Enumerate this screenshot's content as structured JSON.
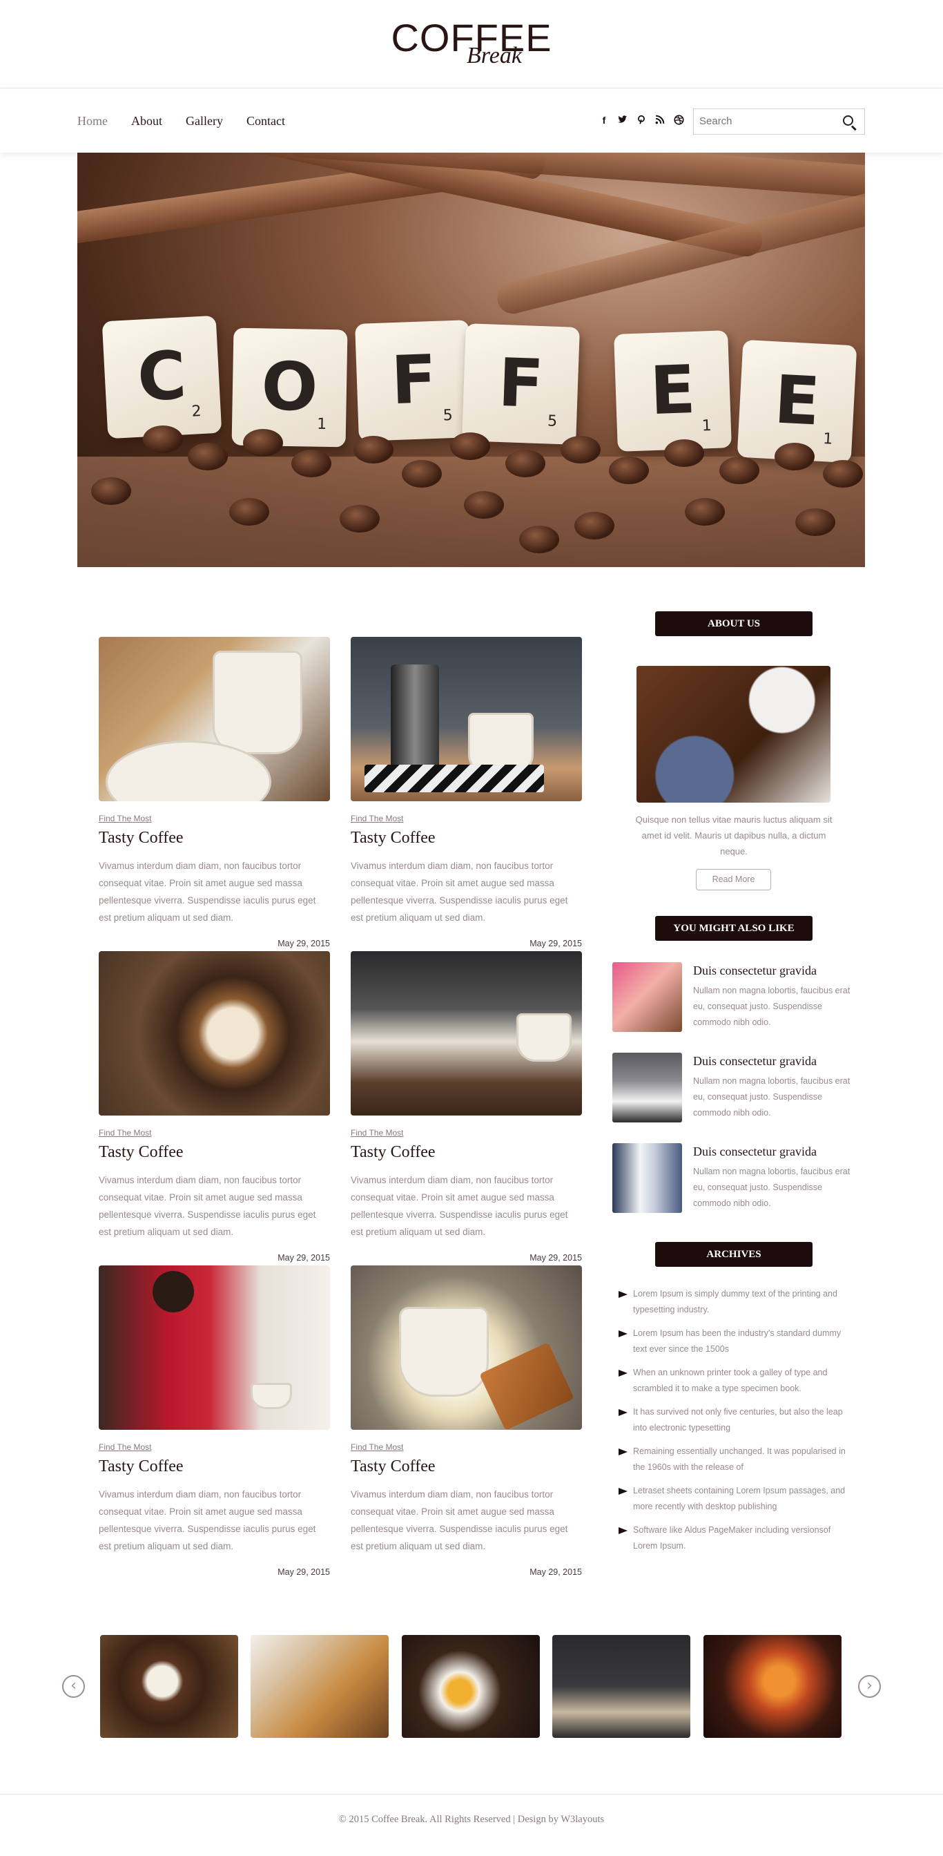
{
  "brand": {
    "name": "COFFEE",
    "script": "Break"
  },
  "nav": {
    "items": [
      {
        "label": "Home",
        "active": true
      },
      {
        "label": "About"
      },
      {
        "label": "Gallery"
      },
      {
        "label": "Contact"
      }
    ],
    "social": [
      "facebook-icon",
      "twitter-icon",
      "pinterest-icon",
      "rss-icon",
      "dribbble-icon"
    ],
    "search_placeholder": "Search"
  },
  "hero": {
    "tiles": [
      {
        "letter": "C",
        "sub": "2"
      },
      {
        "letter": "O",
        "sub": "1"
      },
      {
        "letter": "F",
        "sub": "5"
      },
      {
        "letter": "F",
        "sub": "5"
      },
      {
        "letter": "E",
        "sub": "1"
      },
      {
        "letter": "E",
        "sub": "1"
      }
    ]
  },
  "posts": [
    {
      "category": "Find The Most",
      "title": "Tasty Coffee",
      "body": "Vivamus interdum diam diam, non faucibus tortor consequat vitae. Proin sit amet augue sed massa pellentesque viverra. Suspendisse iaculis purus eget est pretium aliquam ut sed diam.",
      "date": "May 29, 2015"
    },
    {
      "category": "Find The Most",
      "title": "Tasty Coffee",
      "body": "Vivamus interdum diam diam, non faucibus tortor consequat vitae. Proin sit amet augue sed massa pellentesque viverra. Suspendisse iaculis purus eget est pretium aliquam ut sed diam.",
      "date": "May 29, 2015"
    },
    {
      "category": "Find The Most",
      "title": "Tasty Coffee",
      "body": "Vivamus interdum diam diam, non faucibus tortor consequat vitae. Proin sit amet augue sed massa pellentesque viverra. Suspendisse iaculis purus eget est pretium aliquam ut sed diam.",
      "date": "May 29, 2015"
    },
    {
      "category": "Find The Most",
      "title": "Tasty Coffee",
      "body": "Vivamus interdum diam diam, non faucibus tortor consequat vitae. Proin sit amet augue sed massa pellentesque viverra. Suspendisse iaculis purus eget est pretium aliquam ut sed diam.",
      "date": "May 29, 2015"
    },
    {
      "category": "Find The Most",
      "title": "Tasty Coffee",
      "body": "Vivamus interdum diam diam, non faucibus tortor consequat vitae. Proin sit amet augue sed massa pellentesque viverra. Suspendisse iaculis purus eget est pretium aliquam ut sed diam.",
      "date": "May 29, 2015"
    },
    {
      "category": "Find The Most",
      "title": "Tasty Coffee",
      "body": "Vivamus interdum diam diam, non faucibus tortor consequat vitae. Proin sit amet augue sed massa pellentesque viverra. Suspendisse iaculis purus eget est pretium aliquam ut sed diam.",
      "date": "May 29, 2015"
    }
  ],
  "sidebar": {
    "about": {
      "heading": "ABOUT US",
      "text": "Quisque non tellus vitae mauris luctus aliquam sit amet id velit. Mauris ut dapibus nulla, a dictum neque.",
      "button": "Read More"
    },
    "also_like": {
      "heading": "YOU MIGHT ALSO LIKE",
      "items": [
        {
          "title": "Duis consectetur gravida",
          "text": "Nullam non magna lobortis, faucibus erat eu, consequat justo. Suspendisse commodo nibh odio."
        },
        {
          "title": "Duis consectetur gravida",
          "text": "Nullam non magna lobortis, faucibus erat eu, consequat justo. Suspendisse commodo nibh odio."
        },
        {
          "title": "Duis consectetur gravida",
          "text": "Nullam non magna lobortis, faucibus erat eu, consequat justo. Suspendisse commodo nibh odio."
        }
      ]
    },
    "archives": {
      "heading": "ARCHIVES",
      "items": [
        "Lorem Ipsum is simply dummy text of the printing and typesetting industry.",
        "Lorem Ipsum has been the industry's standard dummy text ever since the 1500s",
        "When an unknown printer took a galley of type and scrambled it to make a type specimen book.",
        "It has survived not only five centuries, but also the leap into electronic typesetting",
        "Remaining essentially unchanged. It was popularised in the 1960s with the release of",
        "Letraset sheets containing Lorem Ipsum passages, and more recently with desktop publishing",
        "Software like Aldus PageMaker including versionsof Lorem Ipsum."
      ]
    }
  },
  "gallery": {
    "prev": "‹",
    "next": "›"
  },
  "footer": {
    "text": "© 2015 Coffee Break. All Rights Reserved | Design by W3layouts"
  }
}
